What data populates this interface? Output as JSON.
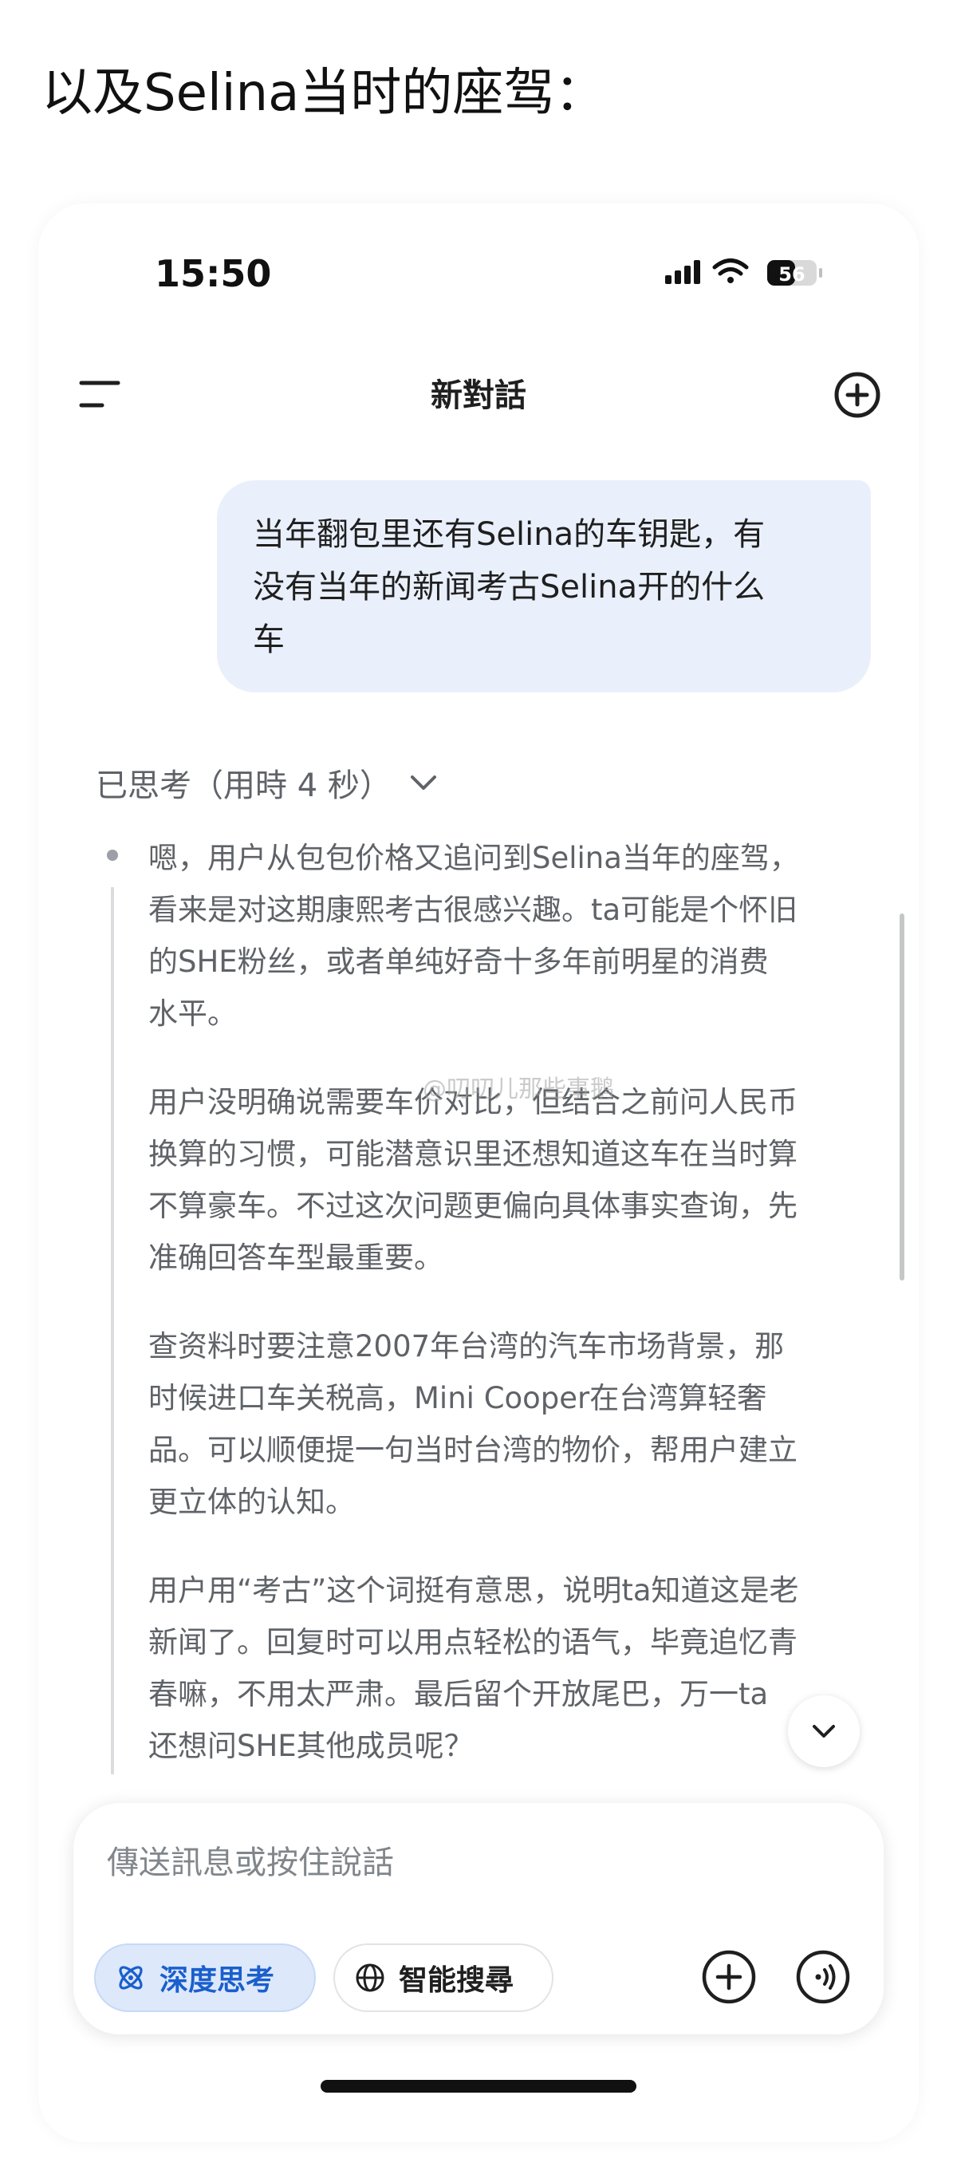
{
  "caption": "以及Selina当时的座驾：",
  "status_bar": {
    "time": "15:50",
    "battery": "56",
    "icons": [
      "signal-icon",
      "wifi-icon",
      "battery-icon"
    ]
  },
  "nav": {
    "title": "新對話",
    "menu_icon": "menu-icon",
    "new_chat_icon": "new-chat-icon"
  },
  "user_message": {
    "lines": [
      "当年翻包里还有Selina的车钥匙，有",
      "没有当年的新闻考古Selina开的什么",
      "车"
    ]
  },
  "thinking": {
    "header": "已思考（用時 4 秒）",
    "paragraphs": [
      [
        "嗯，用户从包包价格又追问到Selina当年的座驾，",
        "看来是对这期康熙考古很感兴趣。ta可能是个怀旧",
        "的SHE粉丝，或者单纯好奇十多年前明星的消费",
        "水平。"
      ],
      [
        "用户没明确说需要车价对比，但结合之前问人民币",
        "换算的习惯，可能潜意识里还想知道这车在当时算",
        "不算豪车。不过这次问题更偏向具体事实查询，先",
        "准确回答车型最重要。"
      ],
      [
        "查资料时要注意2007年台湾的汽车市场背景，那",
        "时候进口车关税高，Mini Cooper在台湾算轻奢",
        "品。可以顺便提一句当时台湾的物价，帮用户建立",
        "更立体的认知。"
      ],
      [
        "用户用“考古”这个词挺有意思，说明ta知道这是老",
        "新闻了。回复时可以用点轻松的语气，毕竟追忆青",
        "春嘛，不用太严肃。最后留个开放尾巴，万一ta",
        "还想问SHE其他成员呢？"
      ]
    ]
  },
  "watermark": "@叨叨儿那些事鹅",
  "composer": {
    "placeholder": "傳送訊息或按住說話",
    "deep_think_label": "深度思考",
    "smart_search_label": "智能搜尋"
  },
  "colors": {
    "user_bubble": "#eaf0fb",
    "accent_blue": "#1a5fcc",
    "deep_think_bg": "#dde8fb",
    "muted_text": "#5f6368"
  }
}
